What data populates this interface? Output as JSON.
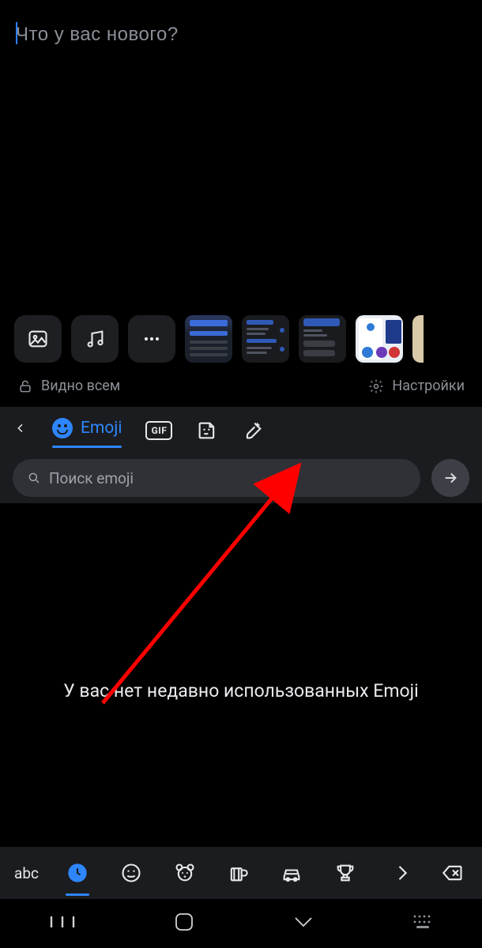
{
  "composer": {
    "placeholder": "Что у вас нового?"
  },
  "meta": {
    "visibility_label": "Видно всем",
    "settings_label": "Настройки"
  },
  "keyboard": {
    "tabs": {
      "emoji_label": "Emoji",
      "gif_label": "GIF"
    },
    "search_placeholder": "Поиск emoji",
    "empty_state": "У вас нет недавно использованных Emoji",
    "abc_label": "abc"
  }
}
